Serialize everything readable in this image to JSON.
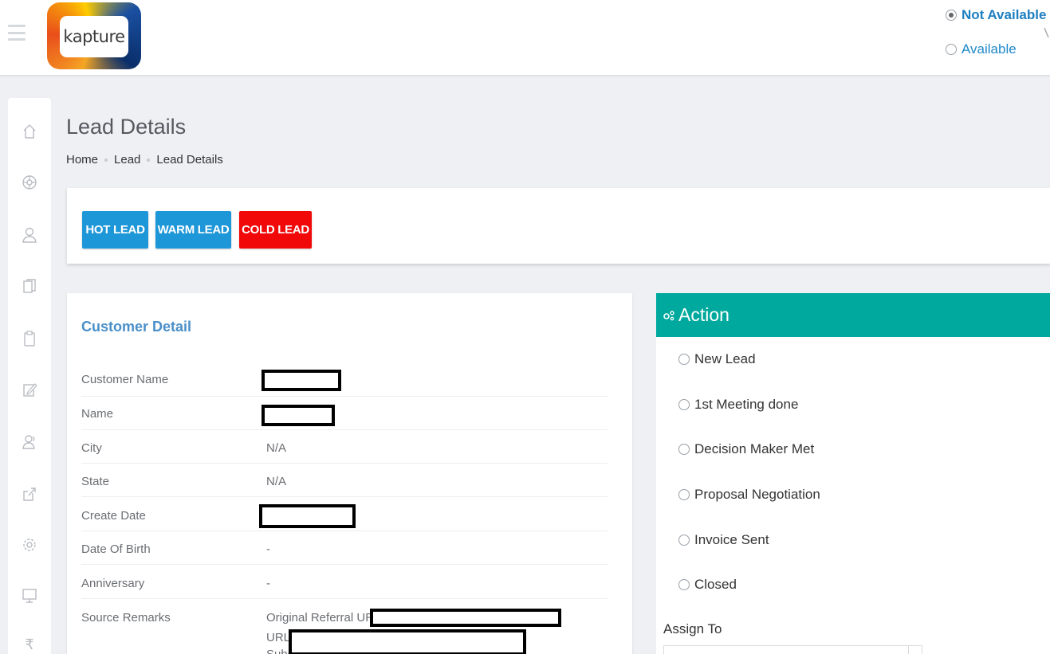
{
  "header": {
    "logo_text": "kapture",
    "availability": [
      {
        "label": "Not Available",
        "selected": true
      },
      {
        "label": "Available",
        "selected": false
      }
    ]
  },
  "sidebar": {
    "icons": [
      "home-icon",
      "globe-icon",
      "user-icon",
      "documents-icon",
      "clipboard-icon",
      "edit-icon",
      "contacts-icon",
      "share-icon",
      "settings-icon",
      "monitor-icon",
      "rupee-icon"
    ],
    "rupee_glyph": "₹"
  },
  "page": {
    "title": "Lead Details",
    "breadcrumb": [
      "Home",
      "Lead",
      "Lead Details"
    ]
  },
  "lead_buttons": {
    "hot": "HOT LEAD",
    "warm": "WARM LEAD",
    "cold": "COLD LEAD",
    "colors": {
      "hot": "#1e97d8",
      "warm": "#1e97d8",
      "cold": "#f10808"
    }
  },
  "customer_detail": {
    "title": "Customer Detail",
    "rows": [
      {
        "label": "Customer Name",
        "value": ""
      },
      {
        "label": "Name",
        "value": ""
      },
      {
        "label": "City",
        "value": "N/A"
      },
      {
        "label": "State",
        "value": "N/A"
      },
      {
        "label": "Create Date",
        "value": ""
      },
      {
        "label": "Date Of Birth",
        "value": "-"
      },
      {
        "label": "Anniversary",
        "value": "-"
      },
      {
        "label": "Source Remarks",
        "value": ""
      }
    ],
    "source_remarks": {
      "original_referral_label": "Original Referral URL :",
      "url_label": "URL :",
      "sub_label": "Subs"
    }
  },
  "action": {
    "title": "Action",
    "accent": "#00a99d",
    "options": [
      "New Lead",
      "1st Meeting done",
      "Decision Maker Met",
      "Proposal Negotiation",
      "Invoice Sent",
      "Closed"
    ],
    "assign_label": "Assign To"
  }
}
